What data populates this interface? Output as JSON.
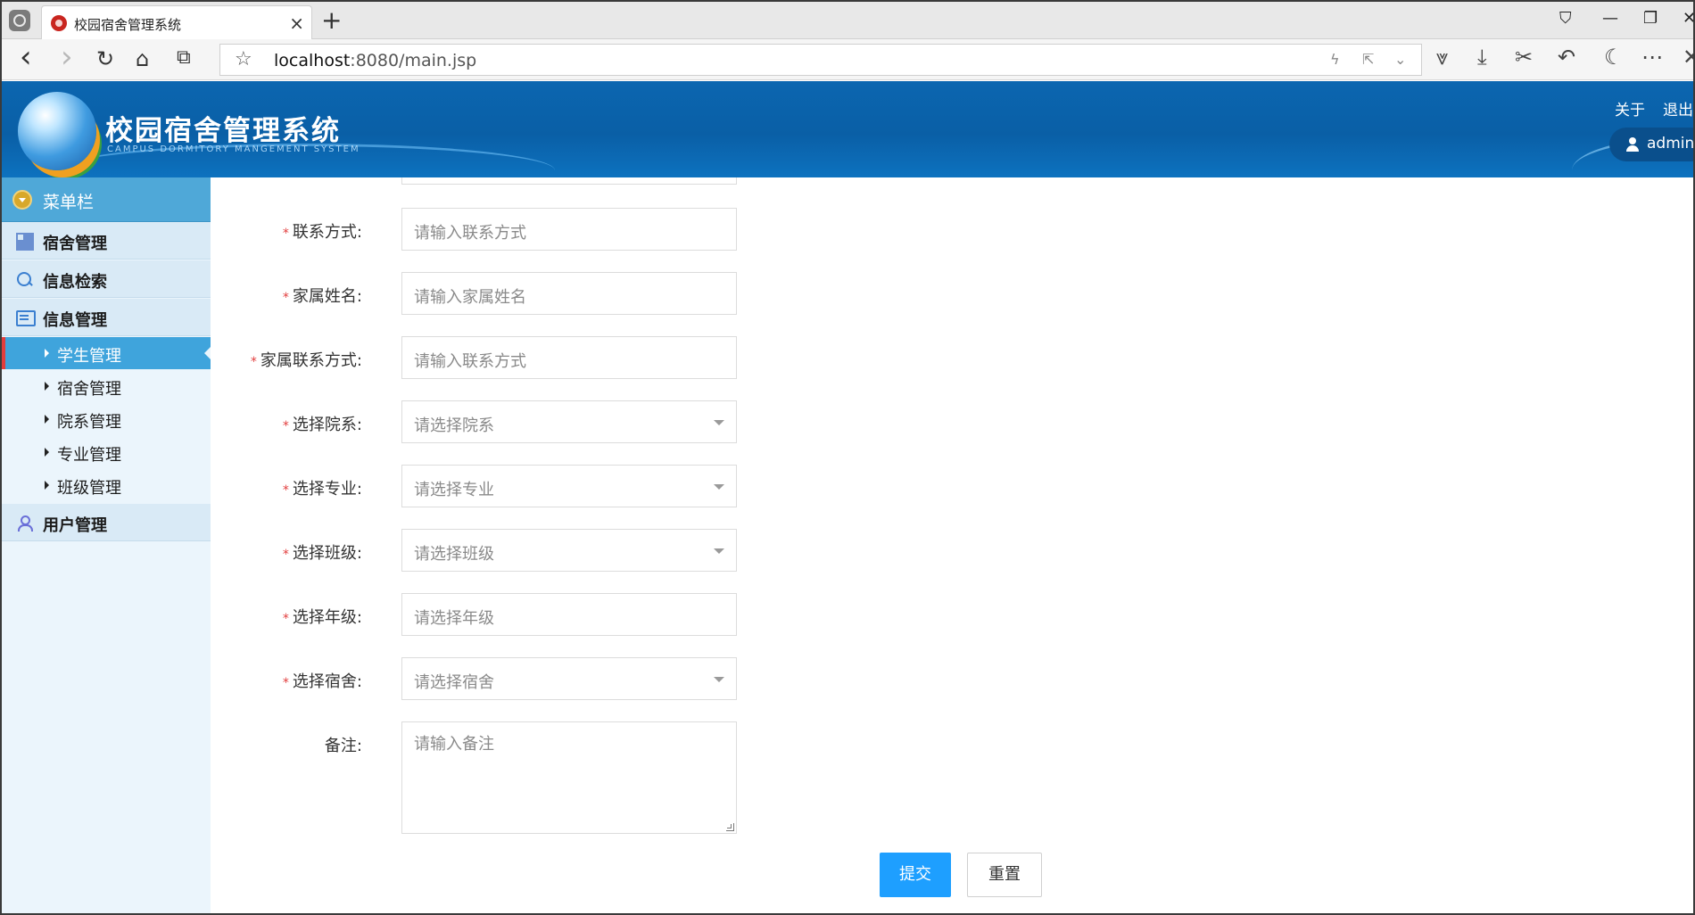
{
  "browser": {
    "tab_title": "校园宿舍管理系统",
    "tab_close": "×",
    "new_tab": "+",
    "url_host": "localhost",
    "url_path": ":8080/main.jsp",
    "window_controls": {
      "pin": "⛉",
      "minimize": "—",
      "restore": "❐",
      "close": "✕"
    },
    "nav": {
      "back": "‹",
      "forward": "›",
      "reload": "↻",
      "home": "⌂",
      "reader": "⧉"
    },
    "url_star": "☆",
    "url_icons": {
      "flash": "ϟ",
      "share": "⇱",
      "dropdown": "⌄"
    },
    "tools": {
      "extensions": "⩔",
      "download": "⤓",
      "cut": "✂",
      "undo": "↶",
      "night": "☾",
      "more": "⋯",
      "close_panel": "✕"
    }
  },
  "header": {
    "title": "校园宿舍管理系统",
    "subtitle": "CAMPUS  DORMITORY  MANGEMENT  SYSTEM",
    "about": "关于",
    "logout": "退出",
    "username": "admin"
  },
  "sidebar": {
    "menu_title": "菜单栏",
    "categories": [
      {
        "label": "宿舍管理",
        "icon": "grid-icon"
      },
      {
        "label": "信息检索",
        "icon": "search-icon"
      },
      {
        "label": "信息管理",
        "icon": "list-icon"
      },
      {
        "label": "用户管理",
        "icon": "person-icon"
      }
    ],
    "info_sub_items": [
      {
        "label": "学生管理",
        "active": true
      },
      {
        "label": "宿舍管理",
        "active": false
      },
      {
        "label": "院系管理",
        "active": false
      },
      {
        "label": "专业管理",
        "active": false
      },
      {
        "label": "班级管理",
        "active": false
      }
    ]
  },
  "form": {
    "fields": [
      {
        "label": "联系方式:",
        "placeholder": "请输入联系方式",
        "required": true,
        "type": "input"
      },
      {
        "label": "家属姓名:",
        "placeholder": "请输入家属姓名",
        "required": true,
        "type": "input"
      },
      {
        "label": "家属联系方式:",
        "placeholder": "请输入联系方式",
        "required": true,
        "type": "input"
      },
      {
        "label": "选择院系:",
        "placeholder": "请选择院系",
        "required": true,
        "type": "select"
      },
      {
        "label": "选择专业:",
        "placeholder": "请选择专业",
        "required": true,
        "type": "select"
      },
      {
        "label": "选择班级:",
        "placeholder": "请选择班级",
        "required": true,
        "type": "select"
      },
      {
        "label": "选择年级:",
        "placeholder": "请选择年级",
        "required": true,
        "type": "input"
      },
      {
        "label": "选择宿舍:",
        "placeholder": "请选择宿舍",
        "required": true,
        "type": "select"
      }
    ],
    "remark": {
      "label": "备注:",
      "placeholder": "请输入备注"
    },
    "required_mark": "*",
    "submit": "提交",
    "reset": "重置"
  }
}
